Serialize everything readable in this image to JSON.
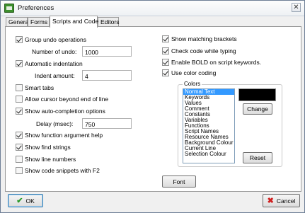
{
  "window": {
    "title": "Preferences",
    "close_glyph": "✕",
    "icon": "app-icon"
  },
  "tabs": [
    {
      "label": "General",
      "active": false
    },
    {
      "label": "Forms",
      "active": false
    },
    {
      "label": "Scripts and Code",
      "active": true
    },
    {
      "label": "Editors",
      "active": false
    }
  ],
  "left": {
    "group_undo": {
      "label": "Group undo operations",
      "checked": true
    },
    "number_of_undo": {
      "label": "Number of undo:",
      "value": "1000"
    },
    "auto_indent": {
      "label": "Automatic indentation",
      "checked": true
    },
    "indent_amount": {
      "label": "Indent amount:",
      "value": "4"
    },
    "smart_tabs": {
      "label": "Smart tabs",
      "checked": false
    },
    "cursor_beyond": {
      "label": "Allow cursor beyond end of line",
      "checked": false
    },
    "auto_completion": {
      "label": "Show auto-completion options",
      "checked": true
    },
    "delay": {
      "label": "Delay (msec):",
      "value": "750"
    },
    "func_help": {
      "label": "Show function argument help",
      "checked": true
    },
    "find_strings": {
      "label": "Show find strings",
      "checked": true
    },
    "line_numbers": {
      "label": "Show line numbers",
      "checked": false
    },
    "snippets": {
      "label": "Show code snippets with F2",
      "checked": false
    }
  },
  "right": {
    "matching_brackets": {
      "label": "Show matching brackets",
      "checked": true
    },
    "check_code": {
      "label": "Check code while typing",
      "checked": true
    },
    "bold_keywords": {
      "label": "Enable BOLD on script keywords.",
      "checked": true
    },
    "color_coding": {
      "label": "Use color coding",
      "checked": true
    },
    "colors_group_title": "Colors",
    "color_items": [
      "Normal Text",
      "Keywords",
      "Values",
      "Comment",
      "Constants",
      "Variables",
      "Functions",
      "Script Names",
      "Resource Names",
      "Background Colour",
      "Current Line",
      "Selection Colour"
    ],
    "selected_index": 0,
    "swatch_color": "#000000",
    "change_button": "Change",
    "reset_button": "Reset",
    "font_button": "Font"
  },
  "footer": {
    "ok_label": "OK",
    "cancel_label": "Cancel"
  }
}
